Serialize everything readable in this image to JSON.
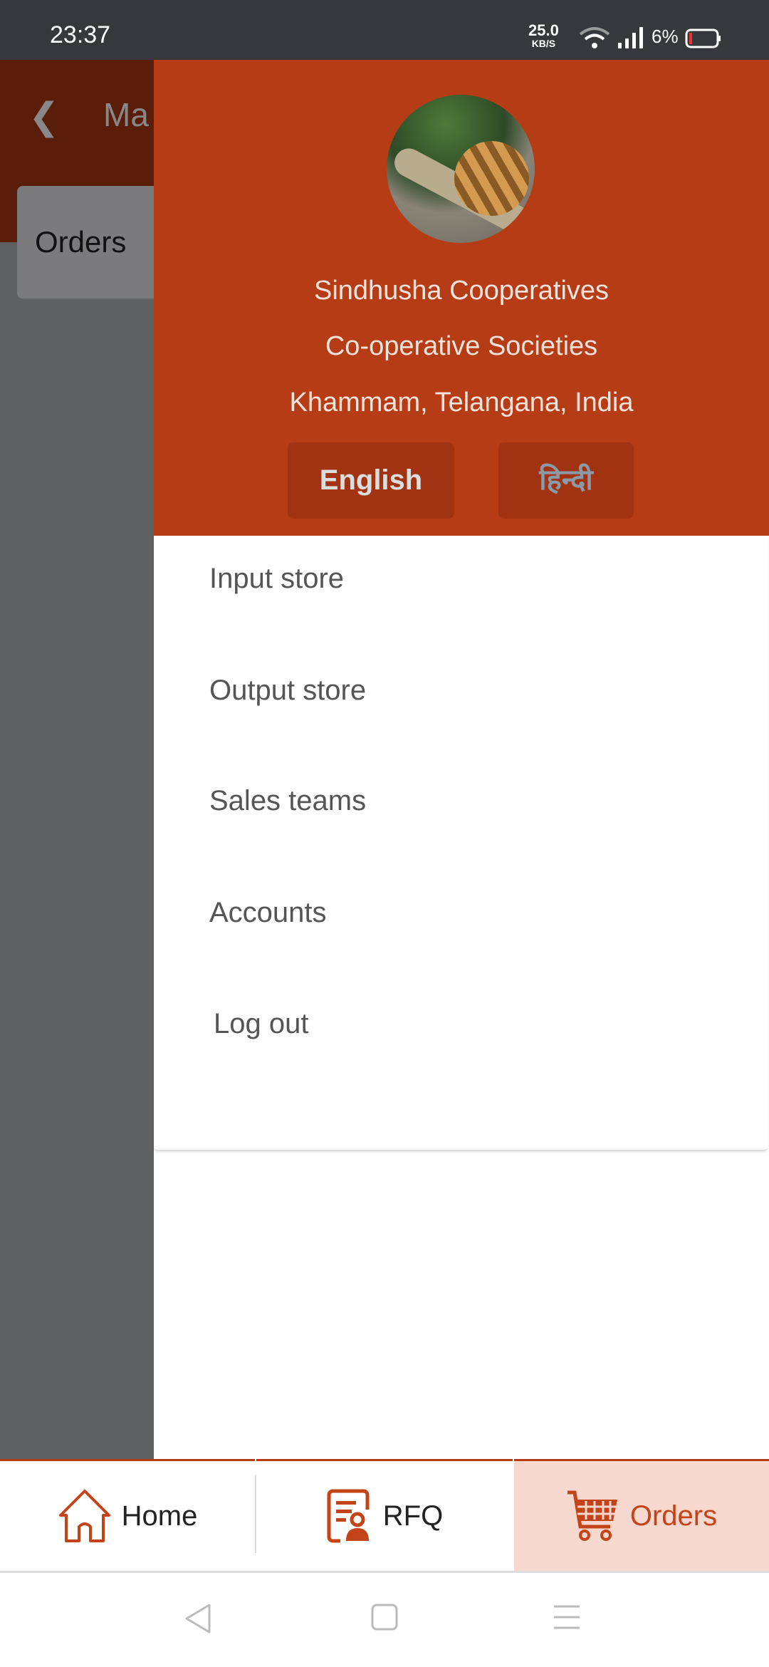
{
  "status_bar": {
    "time": "23:37",
    "net_speed": "25.0",
    "net_unit": "KB/S",
    "battery": "6%"
  },
  "background": {
    "title_partial": "Ma",
    "card_label": "Orders"
  },
  "drawer": {
    "org_name": "Sindhusha Cooperatives",
    "org_type": "Co-operative Societies",
    "location": "Khammam, Telangana, India",
    "languages": [
      "English",
      "हिन्दी"
    ],
    "menu": [
      "Input store",
      "Output store",
      "Sales teams",
      "Accounts",
      "Log out"
    ]
  },
  "bottom_nav": {
    "items": [
      {
        "label": "Home",
        "icon": "home-icon"
      },
      {
        "label": "RFQ",
        "icon": "rfq-document-user-icon"
      },
      {
        "label": "Orders",
        "icon": "cart-icon",
        "active": true
      }
    ]
  },
  "colors": {
    "brand": "#b63c15",
    "active_tab_bg": "#f6d8cf"
  }
}
